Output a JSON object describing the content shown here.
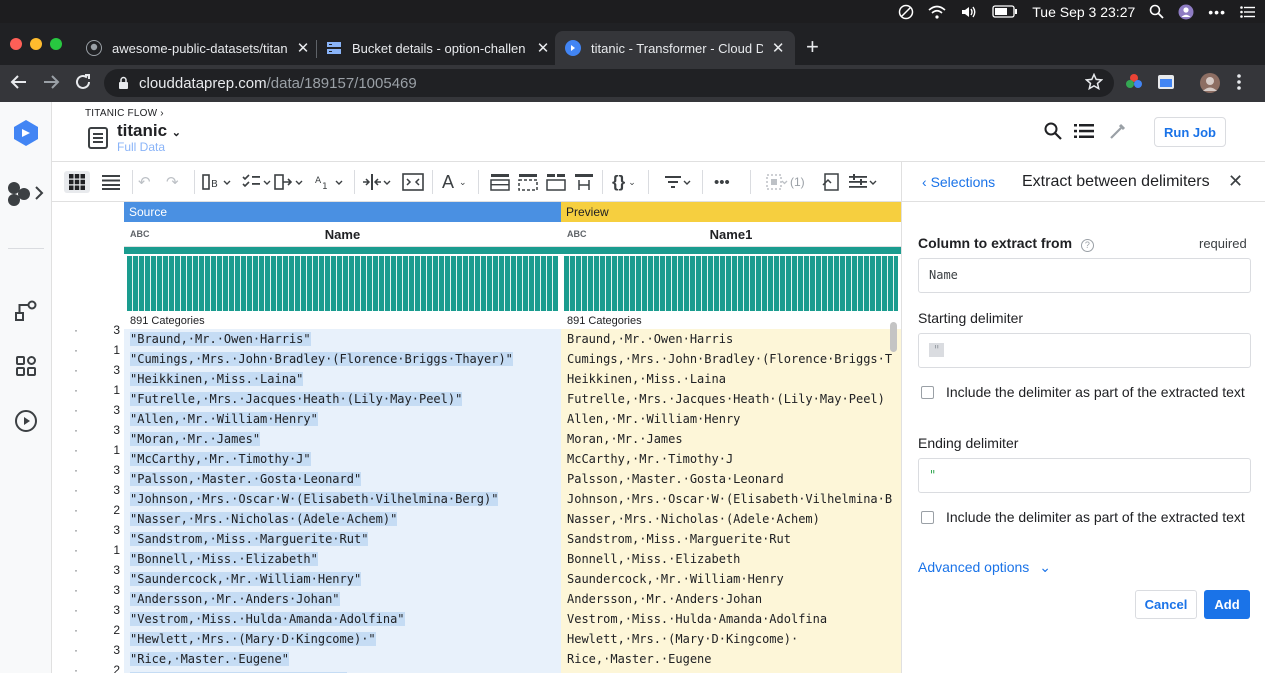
{
  "menubar": {
    "datetime": "Tue Sep 3  23:27"
  },
  "browser": {
    "tabs": [
      {
        "title": "awesome-public-datasets/titan"
      },
      {
        "title": "Bucket details - option-challen"
      },
      {
        "title": "titanic - Transformer - Cloud D"
      }
    ],
    "url_host": "clouddataprep.com",
    "url_path": "/data/189157/1005469"
  },
  "app": {
    "flow_label": "TITANIC FLOW",
    "dataset_title": "titanic",
    "dataset_subtitle": "Full Data",
    "run_job_label": "Run Job",
    "filter_count": "(1)"
  },
  "grid": {
    "source_banner": "Source",
    "preview_banner": "Preview",
    "type_label": "ABC",
    "source_column": "Name",
    "preview_column": "Name1",
    "source_categories": "891 Categories",
    "preview_categories": "891 Categories",
    "rows": [
      {
        "dot": "·",
        "cls": "3",
        "src": "\"Braund,·Mr.·Owen·Harris\"",
        "prev": "Braund,·Mr.·Owen·Harris"
      },
      {
        "dot": "·",
        "cls": "1",
        "src": "\"Cumings,·Mrs.·John·Bradley·(Florence·Briggs·Thayer)\"",
        "prev": "Cumings,·Mrs.·John·Bradley·(Florence·Briggs·T"
      },
      {
        "dot": "·",
        "cls": "3",
        "src": "\"Heikkinen,·Miss.·Laina\"",
        "prev": "Heikkinen,·Miss.·Laina"
      },
      {
        "dot": "·",
        "cls": "1",
        "src": "\"Futrelle,·Mrs.·Jacques·Heath·(Lily·May·Peel)\"",
        "prev": "Futrelle,·Mrs.·Jacques·Heath·(Lily·May·Peel)"
      },
      {
        "dot": "·",
        "cls": "3",
        "src": "\"Allen,·Mr.·William·Henry\"",
        "prev": "Allen,·Mr.·William·Henry"
      },
      {
        "dot": "·",
        "cls": "3",
        "src": "\"Moran,·Mr.·James\"",
        "prev": "Moran,·Mr.·James"
      },
      {
        "dot": "·",
        "cls": "1",
        "src": "\"McCarthy,·Mr.·Timothy·J\"",
        "prev": "McCarthy,·Mr.·Timothy·J"
      },
      {
        "dot": "·",
        "cls": "3",
        "src": "\"Palsson,·Master.·Gosta·Leonard\"",
        "prev": "Palsson,·Master.·Gosta·Leonard"
      },
      {
        "dot": "·",
        "cls": "3",
        "src": "\"Johnson,·Mrs.·Oscar·W·(Elisabeth·Vilhelmina·Berg)\"",
        "prev": "Johnson,·Mrs.·Oscar·W·(Elisabeth·Vilhelmina·B"
      },
      {
        "dot": "·",
        "cls": "2",
        "src": "\"Nasser,·Mrs.·Nicholas·(Adele·Achem)\"",
        "prev": "Nasser,·Mrs.·Nicholas·(Adele·Achem)"
      },
      {
        "dot": "·",
        "cls": "3",
        "src": "\"Sandstrom,·Miss.·Marguerite·Rut\"",
        "prev": "Sandstrom,·Miss.·Marguerite·Rut"
      },
      {
        "dot": "·",
        "cls": "1",
        "src": "\"Bonnell,·Miss.·Elizabeth\"",
        "prev": "Bonnell,·Miss.·Elizabeth"
      },
      {
        "dot": "·",
        "cls": "3",
        "src": "\"Saundercock,·Mr.·William·Henry\"",
        "prev": "Saundercock,·Mr.·William·Henry"
      },
      {
        "dot": "·",
        "cls": "3",
        "src": "\"Andersson,·Mr.·Anders·Johan\"",
        "prev": "Andersson,·Mr.·Anders·Johan"
      },
      {
        "dot": "·",
        "cls": "3",
        "src": "\"Vestrom,·Miss.·Hulda·Amanda·Adolfina\"",
        "prev": "Vestrom,·Miss.·Hulda·Amanda·Adolfina"
      },
      {
        "dot": "·",
        "cls": "2",
        "src": "\"Hewlett,·Mrs.·(Mary·D·Kingcome)·\"",
        "prev": "Hewlett,·Mrs.·(Mary·D·Kingcome)·"
      },
      {
        "dot": "·",
        "cls": "3",
        "src": "\"Rice,·Master.·Eugene\"",
        "prev": "Rice,·Master.·Eugene"
      },
      {
        "dot": "·",
        "cls": "2",
        "src": "\"Williams,·Mr.·Charles·Eugene\"",
        "prev": "Williams,·Mr.·Charles·Eugene"
      }
    ]
  },
  "panel": {
    "back_label": "Selections",
    "title": "Extract between delimiters",
    "column_label": "Column to extract from",
    "required_label": "required",
    "column_value": "Name",
    "start_label": "Starting delimiter",
    "start_value": "\"",
    "include_start_label": "Include the delimiter as part of the extracted text",
    "end_label": "Ending delimiter",
    "end_value": "\"",
    "include_end_label": "Include the delimiter as part of the extracted text",
    "advanced_label": "Advanced options",
    "cancel_label": "Cancel",
    "add_label": "Add"
  }
}
